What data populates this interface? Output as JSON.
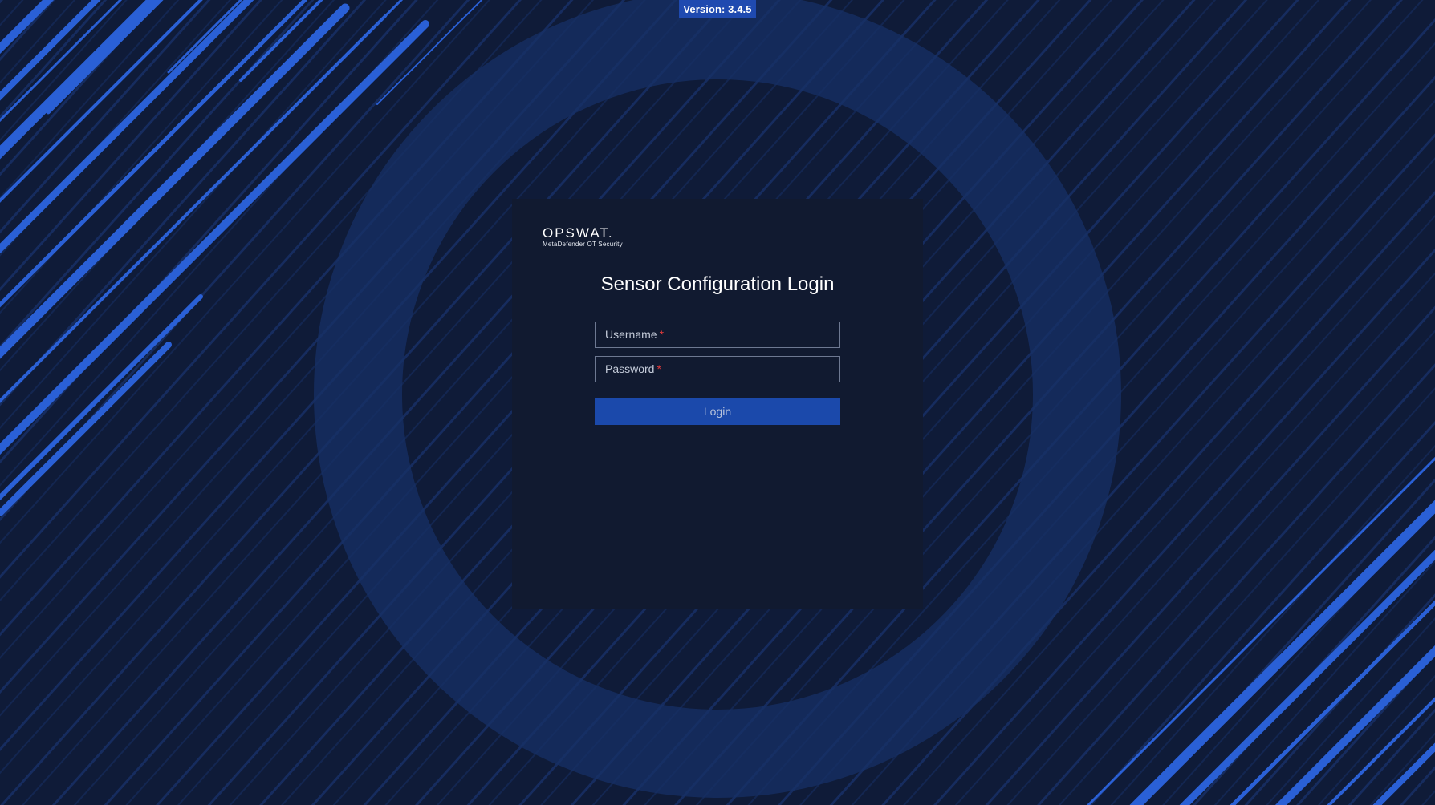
{
  "app": {
    "version_label": "Version: 3.4.5"
  },
  "brand": {
    "name": "OPSWAT.",
    "product": "MetaDefender OT Security"
  },
  "login": {
    "title": "Sensor Configuration Login",
    "username_label": "Username",
    "password_label": "Password",
    "required_marker": "*",
    "button_label": "Login"
  },
  "colors": {
    "background": "#0f1b38",
    "panel": "#111a30",
    "accent": "#1f4ab0",
    "button": "#1b49ab",
    "required": "#e43b3b"
  }
}
